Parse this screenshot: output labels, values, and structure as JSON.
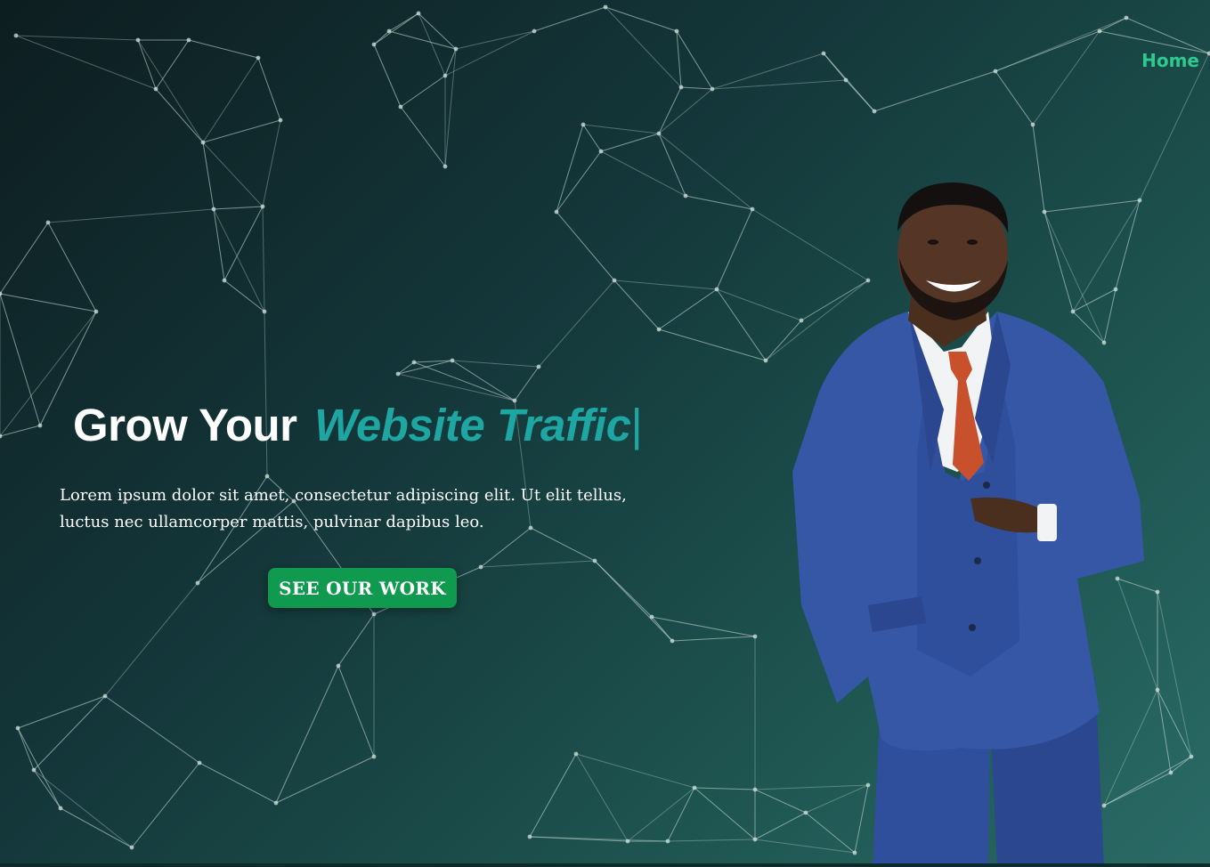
{
  "nav": {
    "home_label": "Home"
  },
  "hero": {
    "headline_static": "Grow Your",
    "headline_accent": "Website Traffic",
    "headline_cursor": "|",
    "lead_text": "Lorem ipsum dolor sit amet, consectetur adipiscing elit. Ut elit tellus, luctus nec ullamcorper mattis, pulvinar dapibus leo.",
    "cta_label": "SEE OUR WORK"
  },
  "colors": {
    "accent_teal": "#1ea6a2",
    "nav_green": "#2ec98f",
    "button_green": "#0f9a4f",
    "suit_blue": "#2f4f9c",
    "tie_orange": "#c9502c"
  },
  "icons": {
    "background": "network-mesh-graphic",
    "person": "smiling-businessman-photo"
  }
}
